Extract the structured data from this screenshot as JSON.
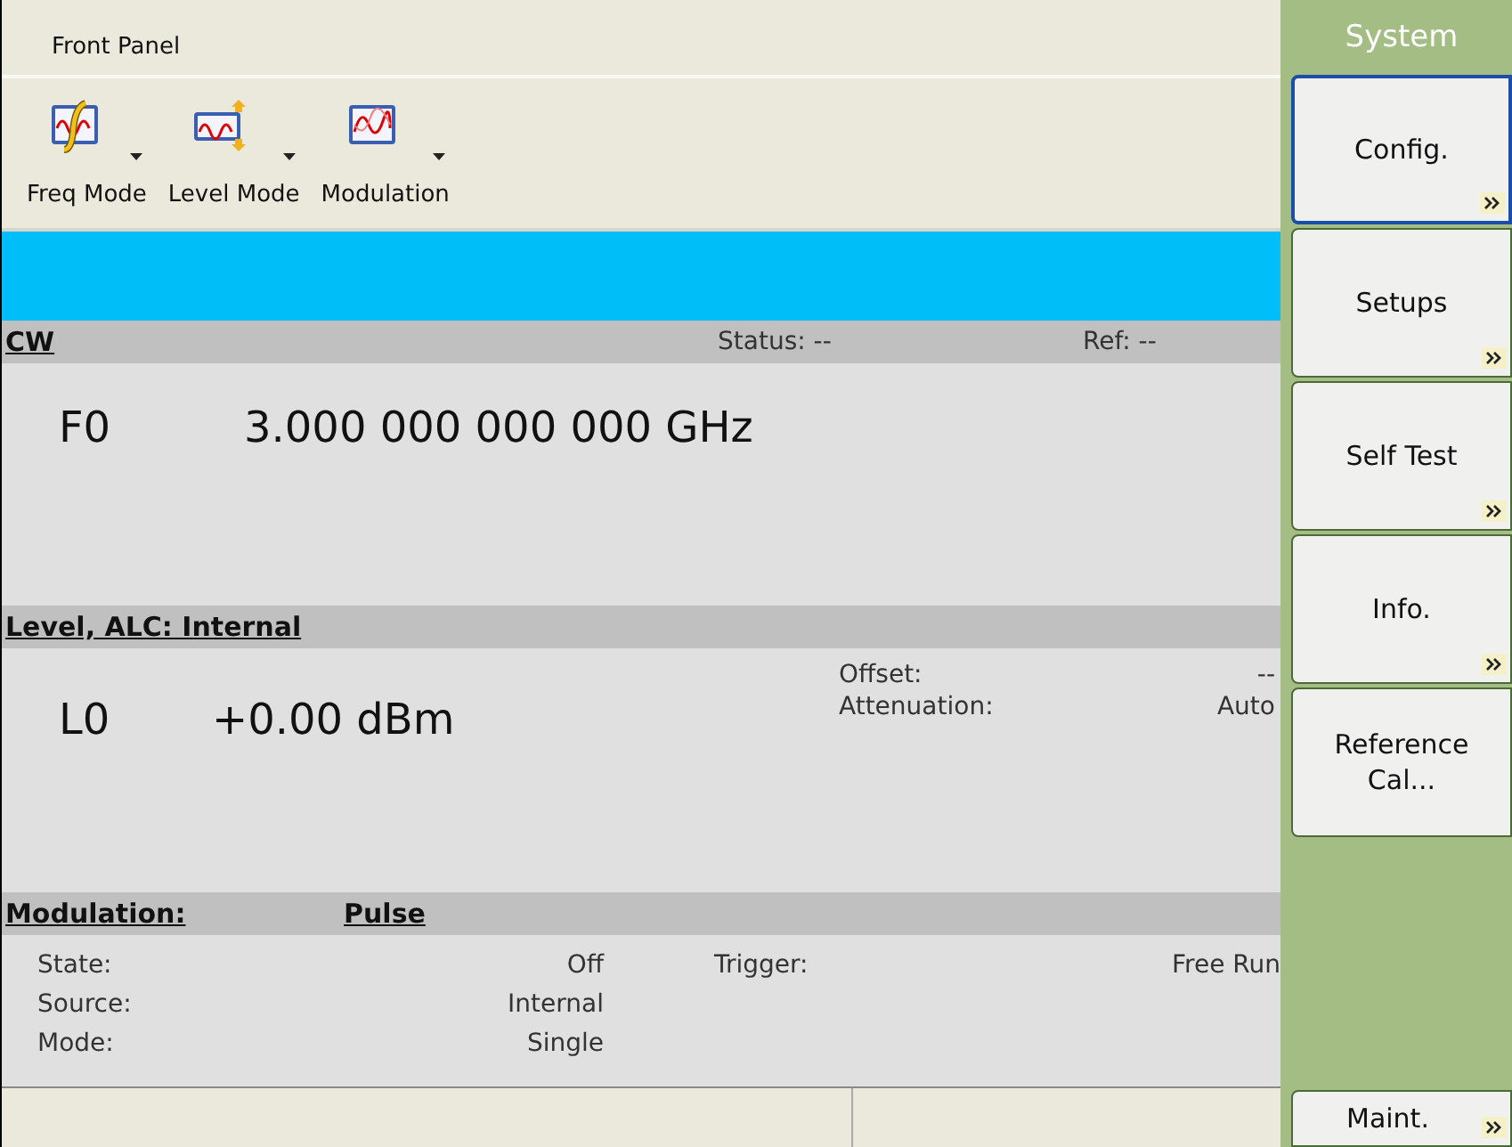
{
  "window": {
    "title": "Front Panel"
  },
  "toolbar": [
    {
      "label": "Freq Mode",
      "kind": "freq"
    },
    {
      "label": "Level Mode",
      "kind": "level"
    },
    {
      "label": "Modulation",
      "kind": "mod"
    }
  ],
  "cw": {
    "title": "CW",
    "status": "Status: --",
    "ref": "Ref: --",
    "name": "F0",
    "value": "3.000 000 000 000 GHz"
  },
  "level": {
    "title": "Level, ALC: Internal",
    "name": "L0",
    "value": "+0.00 dBm",
    "fields": [
      {
        "label": "Offset:",
        "value": "--"
      },
      {
        "label": "Attenuation:",
        "value": "Auto"
      }
    ]
  },
  "modulation": {
    "title": "Modulation:",
    "type": "Pulse",
    "left": [
      {
        "label": "State:",
        "value": "Off"
      },
      {
        "label": "Source:",
        "value": "Internal"
      },
      {
        "label": "Mode:",
        "value": "Single"
      }
    ],
    "right": [
      {
        "label": "Trigger:",
        "value": "Free Run"
      }
    ]
  },
  "menu": {
    "title": "System",
    "buttons": [
      {
        "label": "Config.",
        "submenu": true,
        "focused": true
      },
      {
        "label": "Setups",
        "submenu": true,
        "focused": false
      },
      {
        "label": "Self Test",
        "submenu": true,
        "focused": false
      },
      {
        "label": "Info.",
        "submenu": true,
        "focused": false
      },
      {
        "label": "Reference Cal...",
        "submenu": false,
        "focused": false
      }
    ],
    "bottom": {
      "label": "Maint.",
      "submenu": true
    }
  }
}
